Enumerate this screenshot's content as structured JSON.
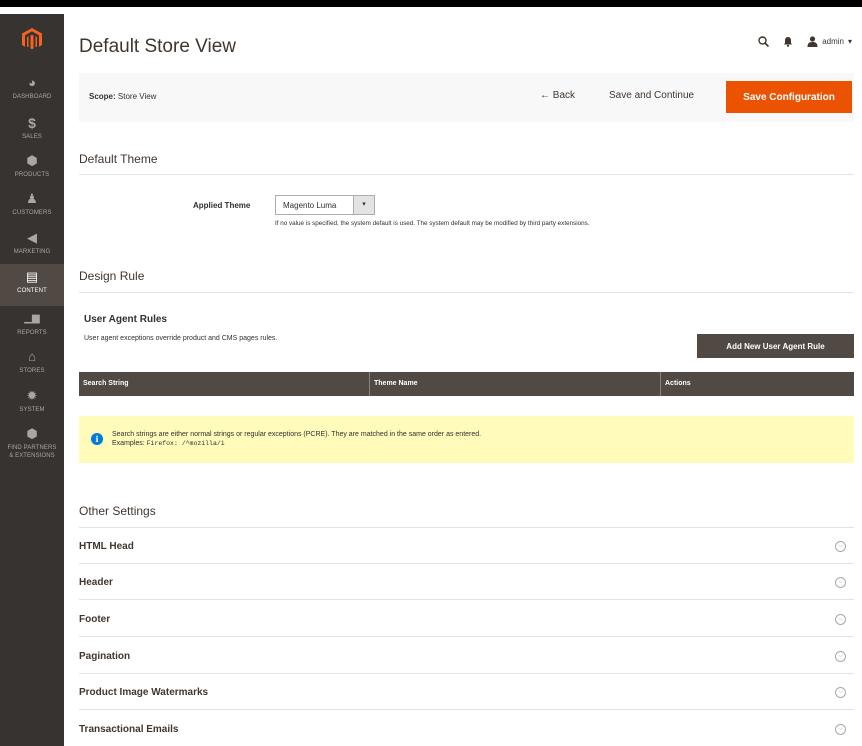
{
  "sidebar": {
    "items": [
      {
        "label": "DASHBOARD",
        "icon": "dashboard-icon",
        "glyph": "◕"
      },
      {
        "label": "SALES",
        "icon": "dollar-icon",
        "glyph": "$"
      },
      {
        "label": "PRODUCTS",
        "icon": "cube-icon",
        "glyph": "⬢"
      },
      {
        "label": "CUSTOMERS",
        "icon": "person-icon",
        "glyph": "♟"
      },
      {
        "label": "MARKETING",
        "icon": "megaphone-icon",
        "glyph": "◀"
      },
      {
        "label": "CONTENT",
        "icon": "content-icon",
        "glyph": "▤"
      },
      {
        "label": "REPORTS",
        "icon": "bar-chart-icon",
        "glyph": "▁▆"
      },
      {
        "label": "STORES",
        "icon": "store-icon",
        "glyph": "⌂"
      },
      {
        "label": "SYSTEM",
        "icon": "gear-icon",
        "glyph": "✹"
      },
      {
        "label": "FIND PARTNERS",
        "label2": "& EXTENSIONS",
        "icon": "partners-icon",
        "glyph": "⬢"
      }
    ],
    "active": "CONTENT"
  },
  "header": {
    "title": "Default Store View",
    "user": "admin"
  },
  "page_actions": {
    "scope_label": "Scope:",
    "scope_value": "Store View",
    "back": "← Back",
    "save_continue": "Save and Continue",
    "save_config": "Save Configuration"
  },
  "default_theme": {
    "section_title": "Default Theme",
    "field_label": "Applied Theme",
    "selected": "Magento Luma",
    "note": "If no value is specified, the system default is used. The system default may be modified by third party extensions."
  },
  "design_rule": {
    "section_title": "Design Rule",
    "ua_title": "User Agent Rules",
    "ua_desc": "User agent exceptions override product and CMS pages rules.",
    "add_button": "Add New User Agent Rule",
    "columns": [
      "Search String",
      "Theme Name",
      "Actions"
    ],
    "notice_line1": "Search strings are either normal strings or regular exceptions (PCRE). They are matched in the same order as entered.",
    "notice_examples": "Examples:",
    "notice_code": "Firefox: /^mozilla/i"
  },
  "other_settings": {
    "section_title": "Other Settings",
    "groups": [
      "HTML Head",
      "Header",
      "Footer",
      "Pagination",
      "Product Image Watermarks",
      "Transactional Emails"
    ]
  },
  "colors": {
    "accent": "#eb5202",
    "sidebar": "#373330",
    "dark_button": "#514943",
    "notice_bg": "#fffbbb"
  }
}
